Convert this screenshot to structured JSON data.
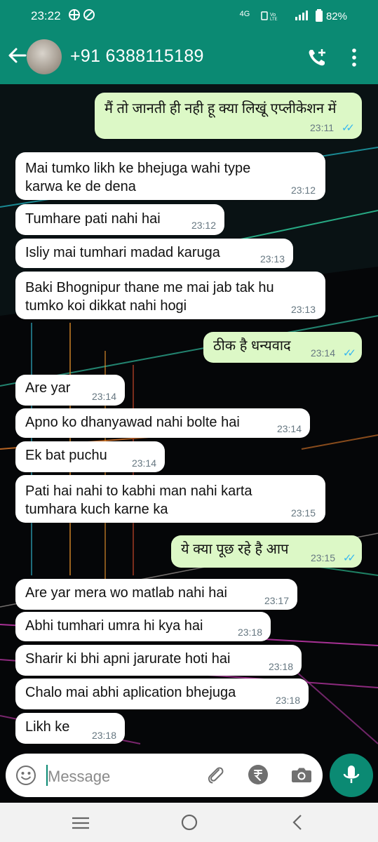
{
  "status_bar": {
    "time": "23:22",
    "network": "4G",
    "battery": "82%"
  },
  "header": {
    "contact_name": "+91 6388115189",
    "back_icon": "arrow-left-icon",
    "call_icon": "add-call-icon",
    "menu_icon": "more-vert-icon"
  },
  "messages": [
    {
      "dir": "out",
      "text": "मैं तो जानती ही नही हू क्या लिखूं एप्लीकेशन में",
      "time": "23:11",
      "read": true
    },
    {
      "dir": "in",
      "text": "Mai tumko likh ke bhejuga wahi type\nkarwa ke de dena",
      "time": "23:12"
    },
    {
      "dir": "in",
      "text": "Tumhare pati nahi hai",
      "time": "23:12"
    },
    {
      "dir": "in",
      "text": "Isliy mai tumhari madad karuga",
      "time": "23:13"
    },
    {
      "dir": "in",
      "text": "Baki Bhognipur thane me mai jab tak hu\ntumko koi dikkat nahi hogi",
      "time": "23:13"
    },
    {
      "dir": "out",
      "text": "ठीक है धन्यवाद",
      "time": "23:14",
      "read": true
    },
    {
      "dir": "in",
      "text": "Are yar",
      "time": "23:14"
    },
    {
      "dir": "in",
      "text": "Apno ko dhanyawad nahi bolte hai",
      "time": "23:14"
    },
    {
      "dir": "in",
      "text": "Ek bat puchu",
      "time": "23:14"
    },
    {
      "dir": "in",
      "text": "Pati hai nahi to kabhi man nahi karta\ntumhara kuch karne ka",
      "time": "23:15"
    },
    {
      "dir": "out",
      "text": "ये क्या पूछ रहे है आप",
      "time": "23:15",
      "read": true
    },
    {
      "dir": "in",
      "text": "Are yar mera wo matlab nahi hai",
      "time": "23:17"
    },
    {
      "dir": "in",
      "text": "Abhi tumhari umra hi kya hai",
      "time": "23:18"
    },
    {
      "dir": "in",
      "text": "Sharir ki bhi apni jarurate hoti hai",
      "time": "23:18"
    },
    {
      "dir": "in",
      "text": "Chalo mai abhi aplication bhejuga",
      "time": "23:18"
    },
    {
      "dir": "in",
      "text": "Likh ke",
      "time": "23:18"
    }
  ],
  "input": {
    "placeholder": "Message"
  },
  "colors": {
    "header": "#0b8a73",
    "outgoing": "#dcf8c6",
    "incoming": "#ffffff",
    "read_tick": "#34b7f1"
  }
}
